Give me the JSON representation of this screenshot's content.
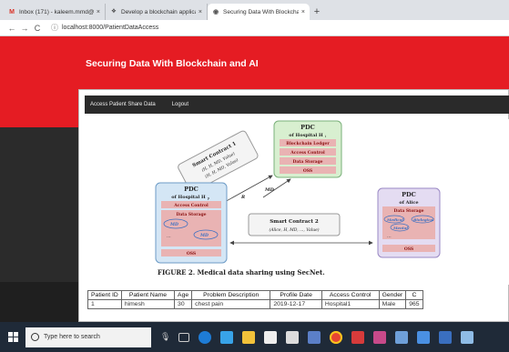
{
  "browser": {
    "tabs": [
      {
        "title": "Inbox (171) - kaleem.mmd@gm...",
        "icon": "gmail-icon",
        "color": "#d93025"
      },
      {
        "title": "Develop a blockchain applicatio...",
        "icon": "github-icon",
        "color": "#333333"
      },
      {
        "title": "Securing Data With Blockchain a...",
        "icon": "web-icon",
        "color": "#555555"
      }
    ],
    "new_tab": "+",
    "close": "×",
    "back": "←",
    "forward": "→",
    "reload": "C",
    "url": "localhost:8000/PatientDataAccess"
  },
  "app": {
    "title": "Securing Data With Blockchain and AI",
    "nav": [
      "Access Patient Share Data",
      "Logout"
    ],
    "brand_color": "#e51c23"
  },
  "figure": {
    "pdc_hi": {
      "title": "PDC",
      "sub": "of Hospital H",
      "sub_sub": "i",
      "rows": [
        "Blockchain Ledger",
        "Access Control",
        "Data Storage",
        "OSS"
      ]
    },
    "pdc_hp": {
      "title": "PDC",
      "sub": "of Hospital H",
      "sub_sub": "p",
      "rows": [
        "Access Control",
        "Data Storage",
        "MD",
        "MD",
        "...",
        "OSS"
      ]
    },
    "pdc_alice": {
      "title": "PDC",
      "sub": "of Alice",
      "rows": [
        "Data Storage",
        "Medical",
        "Biological",
        "Mental",
        "...",
        "OSS"
      ]
    },
    "sc1": {
      "title": "Smart Contract 1",
      "l1": "(H, H, MD, Value)",
      "l2": "(H, H, MD, Value)"
    },
    "sc2": {
      "title": "Smart Contract 2",
      "l1": "(Alice, H, MD, ..., Value)"
    },
    "arrow_labels": [
      "R",
      "MD"
    ],
    "caption": "FIGURE 2.  Medical data sharing using SecNet."
  },
  "table": {
    "headers": [
      "Patient ID",
      "Patient Name",
      "Age",
      "Problem Description",
      "Profile Date",
      "Access Control",
      "Gender",
      "C"
    ],
    "rows": [
      [
        "1",
        "himesh",
        "30",
        "chest pain",
        "2019-12-17",
        "Hospital1",
        "Male",
        "965"
      ]
    ]
  },
  "taskbar": {
    "search_placeholder": "Type here to search"
  }
}
